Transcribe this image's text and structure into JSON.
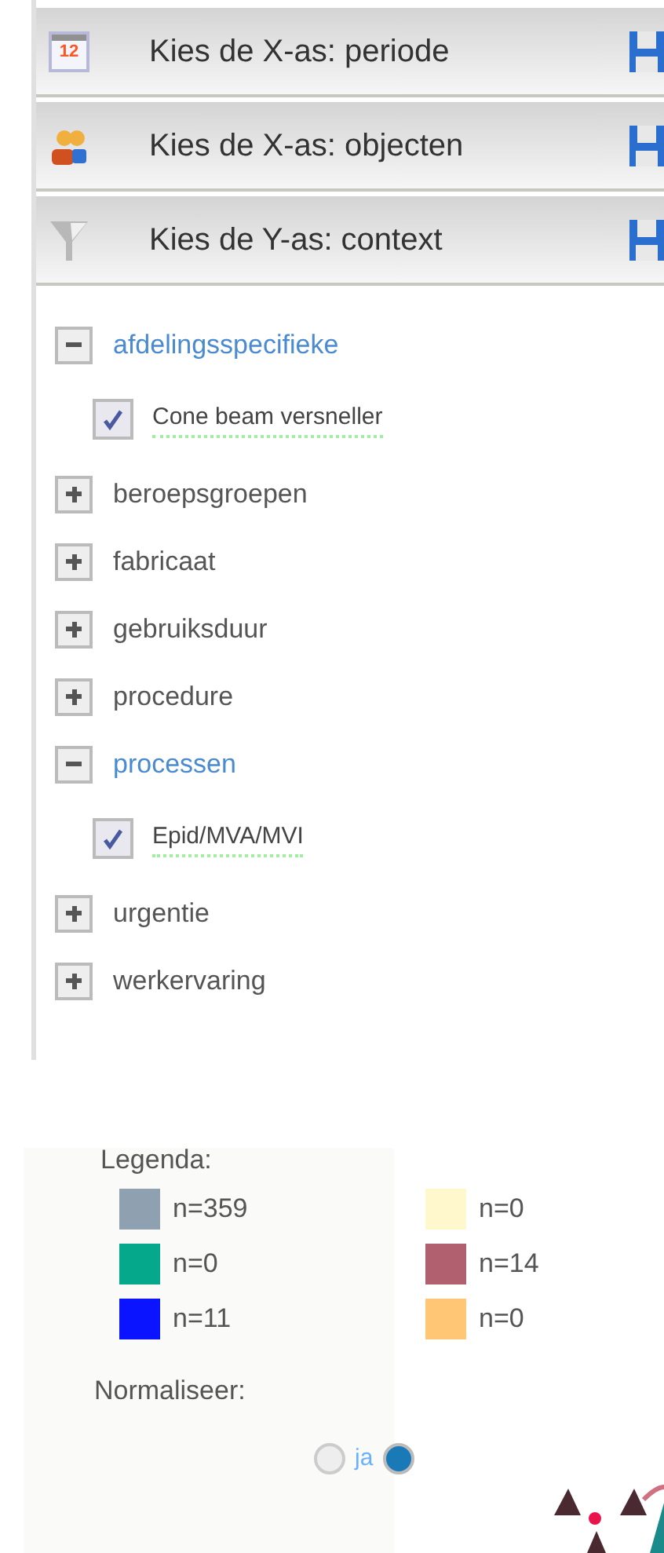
{
  "panels": [
    {
      "kind": "calendar",
      "title": "Kies de X-as: periode",
      "calendar_day": "12"
    },
    {
      "kind": "people",
      "title": "Kies de X-as: objecten"
    },
    {
      "kind": "filter",
      "title": "Kies de Y-as: context"
    }
  ],
  "tree": [
    {
      "label": "afdelingsspecifieke",
      "expanded": true,
      "children": [
        {
          "label": "Cone beam versneller",
          "checked": true
        }
      ]
    },
    {
      "label": "beroepsgroepen",
      "expanded": false
    },
    {
      "label": "fabricaat",
      "expanded": false
    },
    {
      "label": "gebruiksduur",
      "expanded": false
    },
    {
      "label": "procedure",
      "expanded": false
    },
    {
      "label": "processen",
      "expanded": true,
      "children": [
        {
          "label": "Epid/MVA/MVI",
          "checked": true
        }
      ]
    },
    {
      "label": "urgentie",
      "expanded": false
    },
    {
      "label": "werkervaring",
      "expanded": false
    }
  ],
  "legend": {
    "title": "Legenda:",
    "items": [
      {
        "label": "n=359",
        "color": "#8fa0b0"
      },
      {
        "label": "n=0",
        "color": "#fff8cc"
      },
      {
        "label": "n=0",
        "color": "#05a88b"
      },
      {
        "label": "n=14",
        "color": "#b0606f"
      },
      {
        "label": "n=11",
        "color": "#0a14ff"
      },
      {
        "label": "n=0",
        "color": "#ffc775"
      }
    ]
  },
  "normalize": {
    "title": "Normaliseer:",
    "options": [
      {
        "label": "ja",
        "selected": false
      },
      {
        "selected": true
      }
    ]
  }
}
